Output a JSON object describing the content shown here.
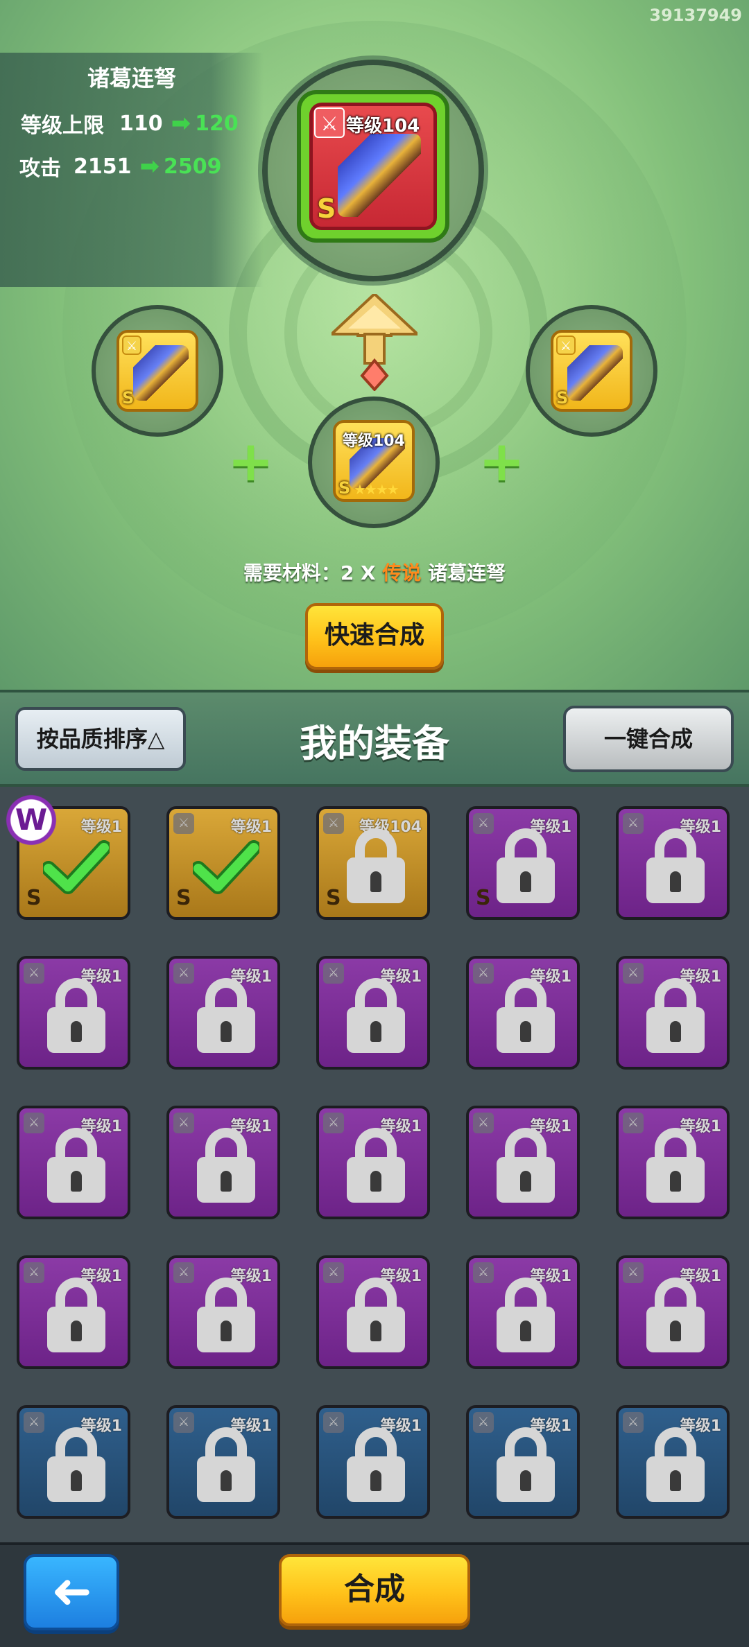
{
  "uid": "39137949",
  "item": {
    "name": "诸葛连弩",
    "level_label": "等级104",
    "rank": "S",
    "level_cap": {
      "label": "等级上限",
      "old": "110",
      "new": "120"
    },
    "attack": {
      "label": "攻击",
      "old": "2151",
      "new": "2509"
    }
  },
  "materials": {
    "slots": [
      {
        "id": "left",
        "rank": "S",
        "level_label": ""
      },
      {
        "id": "center",
        "rank": "S",
        "level_label": "等级104",
        "stars": "★★★★"
      },
      {
        "id": "right",
        "rank": "S",
        "level_label": ""
      }
    ],
    "need_prefix": "需要材料：2 X ",
    "need_quality": "传说",
    "need_name": " 诸葛连弩"
  },
  "buttons": {
    "quick_synth": "快速合成",
    "sort": "按品质排序△",
    "one_key": "一键合成",
    "synth": "合成",
    "back_arrow": "➜"
  },
  "section_title": "我的装备",
  "logo_letter": "W",
  "colors": {
    "legend_orange": "#ff8a1c",
    "arrow_green": "#49e255",
    "card_purple": "#8b3aa6",
    "card_blue": "#2f5f8c",
    "card_gold": "#d9a738"
  },
  "inventory": [
    {
      "level": "等级1",
      "rank": "S",
      "color": "gold",
      "state": "selected"
    },
    {
      "level": "等级1",
      "rank": "S",
      "color": "gold",
      "state": "selected"
    },
    {
      "level": "等级104",
      "rank": "S",
      "color": "gold",
      "state": "locked"
    },
    {
      "level": "等级1",
      "rank": "S",
      "color": "purple",
      "state": "locked"
    },
    {
      "level": "等级1",
      "rank": "",
      "color": "purple",
      "state": "locked"
    },
    {
      "level": "等级1",
      "rank": "",
      "color": "purple",
      "state": "locked"
    },
    {
      "level": "等级1",
      "rank": "",
      "color": "purple",
      "state": "locked"
    },
    {
      "level": "等级1",
      "rank": "",
      "color": "purple",
      "state": "locked"
    },
    {
      "level": "等级1",
      "rank": "",
      "color": "purple",
      "state": "locked"
    },
    {
      "level": "等级1",
      "rank": "",
      "color": "purple",
      "state": "locked"
    },
    {
      "level": "等级1",
      "rank": "",
      "color": "purple",
      "state": "locked"
    },
    {
      "level": "等级1",
      "rank": "",
      "color": "purple",
      "state": "locked"
    },
    {
      "level": "等级1",
      "rank": "",
      "color": "purple",
      "state": "locked"
    },
    {
      "level": "等级1",
      "rank": "",
      "color": "purple",
      "state": "locked"
    },
    {
      "level": "等级1",
      "rank": "",
      "color": "purple",
      "state": "locked"
    },
    {
      "level": "等级1",
      "rank": "",
      "color": "purple",
      "state": "locked"
    },
    {
      "level": "等级1",
      "rank": "",
      "color": "purple",
      "state": "locked"
    },
    {
      "level": "等级1",
      "rank": "",
      "color": "purple",
      "state": "locked"
    },
    {
      "level": "等级1",
      "rank": "",
      "color": "purple",
      "state": "locked"
    },
    {
      "level": "等级1",
      "rank": "",
      "color": "purple",
      "state": "locked"
    },
    {
      "level": "等级1",
      "rank": "",
      "color": "blue",
      "state": "locked"
    },
    {
      "level": "等级1",
      "rank": "",
      "color": "blue",
      "state": "locked"
    },
    {
      "level": "等级1",
      "rank": "",
      "color": "blue",
      "state": "locked"
    },
    {
      "level": "等级1",
      "rank": "",
      "color": "blue",
      "state": "locked"
    },
    {
      "level": "等级1",
      "rank": "",
      "color": "blue",
      "state": "locked"
    }
  ]
}
